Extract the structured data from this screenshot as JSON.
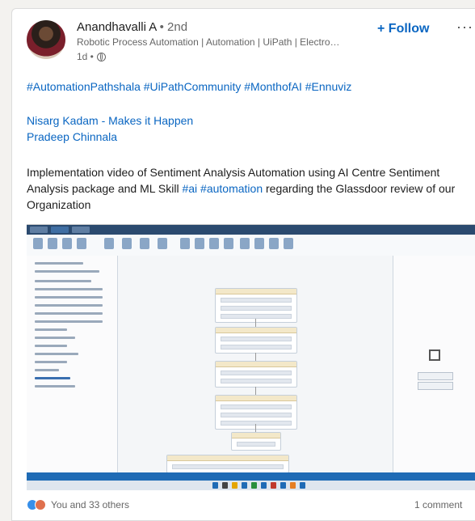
{
  "author": {
    "name": "Anandhavalli A",
    "connection": " • 2nd",
    "headline": "Robotic Process Automation | Automation | UiPath | Electro…",
    "time": "1d •"
  },
  "actions": {
    "follow": "+ Follow",
    "more": "···"
  },
  "post": {
    "hashtags": "#AutomationPathshala #UiPathCommunity #MonthofAI #Ennuviz",
    "mention1": "Nisarg Kadam - Makes it Happen",
    "mention2": "Pradeep Chinnala",
    "desc_part1": "Implementation video of Sentiment Analysis Automation using AI Centre Sentiment Analysis package and ML Skill ",
    "tag_ai": "#ai",
    "tag_automation": "#automation",
    "desc_part2": " regarding the Glassdoor review of our Organization"
  },
  "social": {
    "reactions": "You and 33 others",
    "comments": "1 comment"
  },
  "colors": {
    "link": "#0a66c2",
    "like": "#378fe9",
    "love": "#df704d"
  },
  "icons": {
    "visibility": "globe-icon",
    "like": "like-reaction-icon",
    "love": "love-reaction-icon"
  }
}
